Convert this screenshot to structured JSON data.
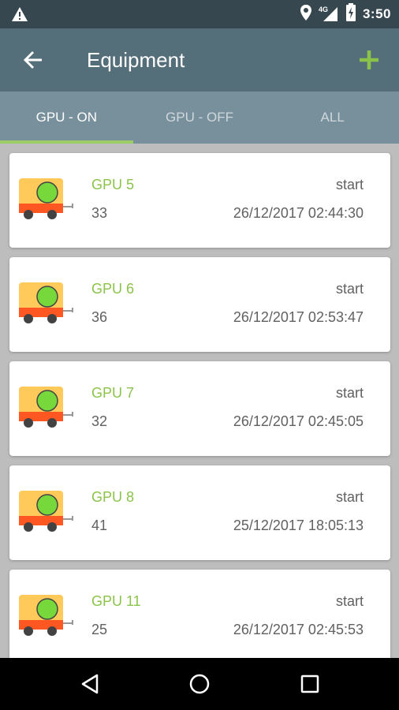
{
  "status_bar": {
    "time": "3:50",
    "network": "4G",
    "icons": [
      "warning-icon",
      "location-icon",
      "signal-icon",
      "battery-charging-icon"
    ]
  },
  "app_bar": {
    "title": "Equipment",
    "back_icon": "arrow-back-icon",
    "add_icon": "add-icon"
  },
  "tabs": [
    {
      "label": "GPU - ON",
      "active": true
    },
    {
      "label": "GPU - OFF",
      "active": false
    },
    {
      "label": "ALL",
      "active": false
    }
  ],
  "items": [
    {
      "name": "GPU 5",
      "number": "33",
      "status": "start",
      "datetime": "26/12/2017 02:44:30"
    },
    {
      "name": "GPU 6",
      "number": "36",
      "status": "start",
      "datetime": "26/12/2017 02:53:47"
    },
    {
      "name": "GPU 7",
      "number": "32",
      "status": "start",
      "datetime": "26/12/2017 02:45:05"
    },
    {
      "name": "GPU 8",
      "number": "41",
      "status": "start",
      "datetime": "25/12/2017 18:05:13"
    },
    {
      "name": "GPU 11",
      "number": "25",
      "status": "start",
      "datetime": "26/12/2017 02:45:53"
    }
  ],
  "nav_bar": {
    "buttons": [
      "back-triangle-icon",
      "home-circle-icon",
      "recents-square-icon"
    ]
  },
  "colors": {
    "status_bar": "#37474f",
    "app_bar": "#546e7a",
    "tab_bar": "#78909c",
    "accent_green": "#8bc34a",
    "list_bg": "#bdbdbd"
  }
}
